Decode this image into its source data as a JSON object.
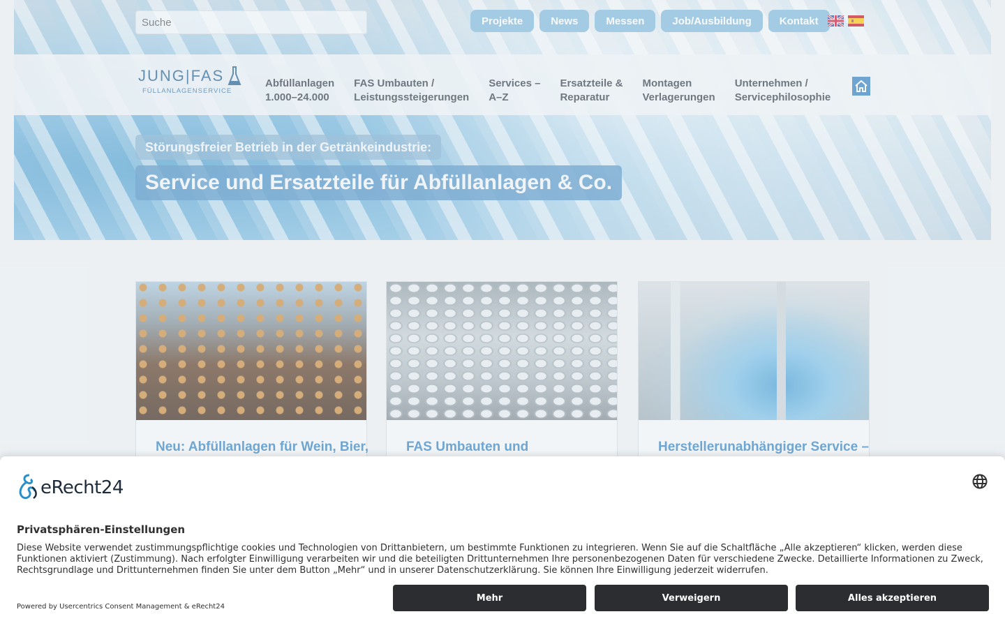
{
  "search": {
    "placeholder": "Suche"
  },
  "top_links": [
    "Projekte",
    "News",
    "Messen",
    "Job/Ausbildung",
    "Kontakt"
  ],
  "languages": [
    {
      "icon": "uk-flag-icon"
    },
    {
      "icon": "spain-flag-icon"
    }
  ],
  "logo": {
    "main": "JUNG|FAS",
    "sub": "FÜLLANLAGENSERVICE"
  },
  "nav": [
    "Abfüllanlagen\n1.000–24.000",
    "FAS Umbauten /\nLeistungssteigerungen",
    "Services –\nA–Z",
    "Ersatzteile &\nReparatur",
    "Montagen\nVerlagerungen",
    "Unternehmen /\nServicephilosophie"
  ],
  "hero": {
    "subtitle": "Störungsfreier Betrieb in der Getränkeindustrie:",
    "title": "Service und Ersatzteile für Abfüllanlagen & Co."
  },
  "cards": [
    {
      "title": "Neu: Abfüllanlagen für Wein, Bier,",
      "image": "beer-bottles-conveyor"
    },
    {
      "title": "FAS Umbauten und",
      "image": "cans-conveyor"
    },
    {
      "title": "Herstellerunabhängiger Service –",
      "image": "water-bottle-filling"
    }
  ],
  "consent": {
    "brand": "eRecht24",
    "title": "Privatsphären-Einstellungen",
    "text": "Diese Website verwendet zustimmungspflichtige cookies und Technologien von Drittanbietern, um bestimmte Funktionen zu integrieren. Wenn Sie auf die Schaltfläche „Alle akzeptieren“ klicken, werden diese Funktionen aktiviert (Zustimmung). Nach erfolgter Einwilligung verarbeiten wir und die beteiligten Drittunternehmen Ihre personenbezogenen Daten für verschiedene Zwecke. Detaillierte Informationen zu Zweck, Rechtsgrundlage und Drittunternehmen finden Sie unter dem Button „Mehr“ und in unserer Datenschutzerklärung. Sie können Ihre Einwilligung jederzeit widerrufen.",
    "powered_by": "Powered by Usercentrics Consent Management & eRecht24",
    "buttons": {
      "more": "Mehr",
      "deny": "Verweigern",
      "accept_all": "Alles akzeptieren"
    }
  },
  "colors": {
    "accent_blue": "#2e7dc1",
    "button_dark": "#2b2d31",
    "card_title": "#2f7fc1"
  }
}
